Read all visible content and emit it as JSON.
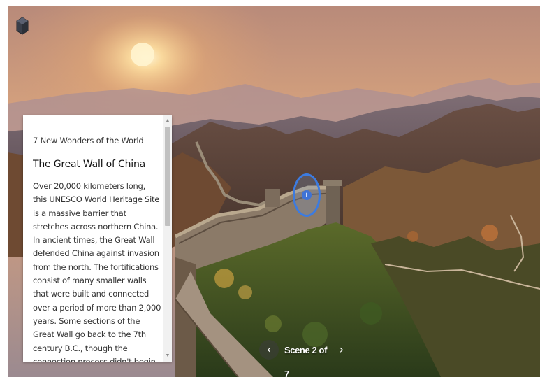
{
  "viewer": {
    "logo_icon": "cube-logo-icon"
  },
  "info_card": {
    "eyebrow": "7 New Wonders of the World",
    "title": "The Great Wall of China",
    "body": "Over 20,000 kilometers long, this UNESCO World Heritage Site is a massive barrier that stretches across northern China. In ancient times, the Great Wall defended China against invasion from the north. The fortifications consist of many smaller walls that were built and connected over a period of more than 2,000 years. Some sections of the Great Wall go back to the 7th century B.C., though the connection process didn't begin until the",
    "scroll_up_icon": "chevron-up-icon",
    "scroll_down_icon": "chevron-down-icon"
  },
  "hotspot": {
    "icon": "info-hotspot-icon"
  },
  "scene_nav": {
    "prev_icon": "chevron-left-icon",
    "next_icon": "chevron-right-icon",
    "prev_glyph": "‹",
    "next_glyph": "›",
    "label": "Scene 2 of 7"
  }
}
